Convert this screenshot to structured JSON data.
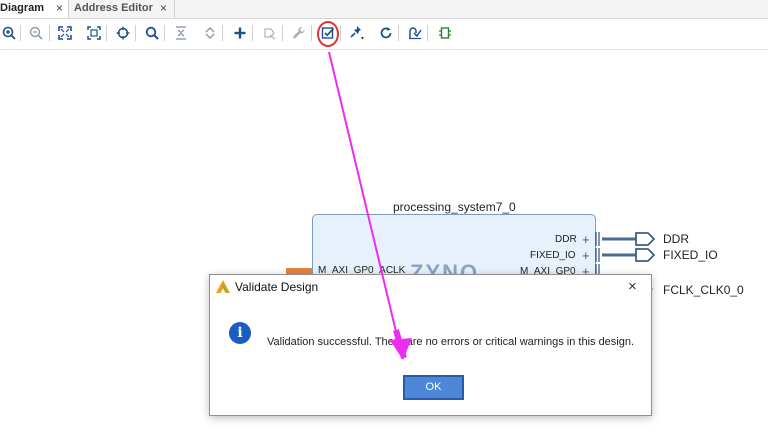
{
  "tabs": [
    {
      "label": "Diagram",
      "close": "×"
    },
    {
      "label": "Address Editor",
      "close": "×"
    }
  ],
  "toolbar": {
    "buttons": [
      {
        "name": "zoom-in",
        "icon": "zoom-in-icon"
      },
      {
        "name": "zoom-out",
        "icon": "zoom-out-icon"
      },
      {
        "name": "zoom-fit",
        "icon": "fit-icon"
      },
      {
        "name": "fit-selection",
        "icon": "fit-selection-icon"
      },
      {
        "name": "select-area",
        "icon": "crosshair-icon"
      },
      {
        "name": "search",
        "icon": "search-icon"
      },
      {
        "name": "collapse-all",
        "icon": "collapse-icon"
      },
      {
        "name": "expand-all",
        "icon": "expand-icon"
      },
      {
        "name": "add-ip",
        "icon": "plus-icon"
      },
      {
        "name": "make-external",
        "icon": "arrow-icon"
      },
      {
        "name": "properties",
        "icon": "wrench-icon"
      },
      {
        "name": "validate-design",
        "icon": "validate-icon"
      },
      {
        "name": "pin",
        "icon": "pin-icon"
      },
      {
        "name": "regenerate-layout",
        "icon": "refresh-icon"
      },
      {
        "name": "run-connection-automation",
        "icon": "connection-icon"
      },
      {
        "name": "ip-settings",
        "icon": "chip-icon"
      }
    ]
  },
  "block": {
    "title": "processing_system7_0",
    "ports_right": [
      "DDR",
      "FIXED_IO",
      "M_AXI_GP0"
    ],
    "port_left": "M_AXI_GP0_ACLK",
    "logo_text": "ZYNQ",
    "external_ports": [
      "DDR",
      "FIXED_IO",
      "FCLK_CLK0_0"
    ]
  },
  "dialog": {
    "title": "Validate Design",
    "close": "×",
    "message": "Validation successful. There are no errors or critical warnings in this design.",
    "ok_label": "OK",
    "info_glyph": "i"
  },
  "colors": {
    "annotation_arrow": "#ee2cf0",
    "highlight_ring": "#e03434",
    "block_fill": "#e7f1fc",
    "ok_button": "#4d88d8"
  }
}
